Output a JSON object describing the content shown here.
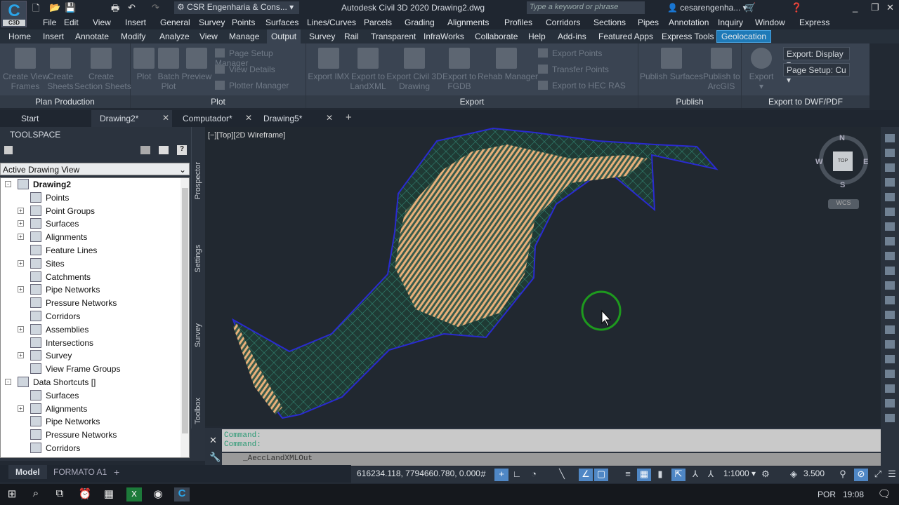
{
  "title_bar": {
    "app_logo": "C",
    "app_logo_sub": "C3D",
    "workspace": "CSR Engenharia & Cons...",
    "title": "Autodesk Civil 3D 2020   Drawing2.dwg",
    "search_placeholder": "Type a keyword or phrase",
    "user": "cesarengenha..."
  },
  "menu": [
    "File",
    "Edit",
    "View",
    "Insert",
    "General",
    "Survey",
    "Points",
    "Surfaces",
    "Lines/Curves",
    "Parcels",
    "Grading",
    "Alignments",
    "Profiles",
    "Corridors",
    "Sections",
    "Pipes",
    "Annotation",
    "Inquiry",
    "Window",
    "Express"
  ],
  "ribbon_tabs": [
    "Home",
    "Insert",
    "Annotate",
    "Modify",
    "Analyze",
    "View",
    "Manage",
    "Output",
    "Survey",
    "Rail",
    "Transparent",
    "InfraWorks",
    "Collaborate",
    "Help",
    "Add-ins",
    "Featured Apps",
    "Express Tools",
    "Geolocation"
  ],
  "active_tab": "Output",
  "panels": {
    "plan_production": {
      "title": "Plan Production",
      "buttons": [
        "Create View\nFrames",
        "Create\nSheets",
        "Create\nSection Sheets"
      ]
    },
    "plot": {
      "title": "Plot",
      "buttons": [
        "Plot",
        "Batch\nPlot",
        "Preview"
      ],
      "small": [
        "Page Setup Manager",
        "View Details",
        "Plotter Manager"
      ]
    },
    "export": {
      "title": "Export",
      "buttons": [
        "Export IMX",
        "Export to\nLandXML",
        "Export Civil 3D\nDrawing",
        "Export to\nFGDB",
        "Rehab Manager"
      ],
      "small": [
        "Export Points",
        "Transfer Points",
        "Export to HEC RAS"
      ]
    },
    "publish": {
      "title": "Publish",
      "buttons": [
        "Publish Surfaces",
        "Publish to\nArcGIS"
      ]
    },
    "export_dwf": {
      "title": "Export to DWF/PDF",
      "button": "Export",
      "export_select": "Export: Display",
      "page_setup_select": "Page Setup: Cu"
    }
  },
  "doc_tabs": [
    {
      "label": "Start"
    },
    {
      "label": "Drawing2*",
      "active": true
    },
    {
      "label": "Computador*"
    },
    {
      "label": "Drawing5*"
    }
  ],
  "toolspace": {
    "header": "TOOLSPACE",
    "view_select": "Active Drawing View",
    "side_tabs": [
      "Prospector",
      "Settings",
      "Survey",
      "Toolbox"
    ],
    "tree": [
      {
        "label": "Drawing2",
        "level": 0,
        "expand": "-",
        "bold": true
      },
      {
        "label": "Points",
        "level": 1
      },
      {
        "label": "Point Groups",
        "level": 1,
        "expand": "+"
      },
      {
        "label": "Surfaces",
        "level": 1,
        "expand": "+"
      },
      {
        "label": "Alignments",
        "level": 1,
        "expand": "+"
      },
      {
        "label": "Feature Lines",
        "level": 1
      },
      {
        "label": "Sites",
        "level": 1,
        "expand": "+"
      },
      {
        "label": "Catchments",
        "level": 1
      },
      {
        "label": "Pipe Networks",
        "level": 1,
        "expand": "+"
      },
      {
        "label": "Pressure Networks",
        "level": 1
      },
      {
        "label": "Corridors",
        "level": 1
      },
      {
        "label": "Assemblies",
        "level": 1,
        "expand": "+"
      },
      {
        "label": "Intersections",
        "level": 1
      },
      {
        "label": "Survey",
        "level": 1,
        "expand": "+"
      },
      {
        "label": "View Frame Groups",
        "level": 1
      },
      {
        "label": "Data Shortcuts []",
        "level": 0,
        "expand": "-"
      },
      {
        "label": "Surfaces",
        "level": 1
      },
      {
        "label": "Alignments",
        "level": 1,
        "expand": "+"
      },
      {
        "label": "Pipe Networks",
        "level": 1
      },
      {
        "label": "Pressure Networks",
        "level": 1
      },
      {
        "label": "Corridors",
        "level": 1
      }
    ]
  },
  "viewport": {
    "label": "[−][Top][2D Wireframe]",
    "viewcube": {
      "top": "TOP",
      "n": "N",
      "s": "S",
      "e": "E",
      "w": "W",
      "wcs": "WCS"
    }
  },
  "command": {
    "history": [
      "Command:",
      "Command:"
    ],
    "input": "_AeccLandXMLOut"
  },
  "layout_tabs": [
    "Model",
    "FORMATO A1"
  ],
  "status": {
    "coords": "616234.118, 7794660.780, 0.000",
    "scale": "1:1000",
    "lineweight": "3.500"
  },
  "taskbar": {
    "lang": "POR",
    "time": "19:08"
  },
  "colors": {
    "accent": "#1e7ab8",
    "surface": "#e8b07a",
    "boundary": "#2a2ad0",
    "cursor_ring": "#1e9a1e"
  }
}
